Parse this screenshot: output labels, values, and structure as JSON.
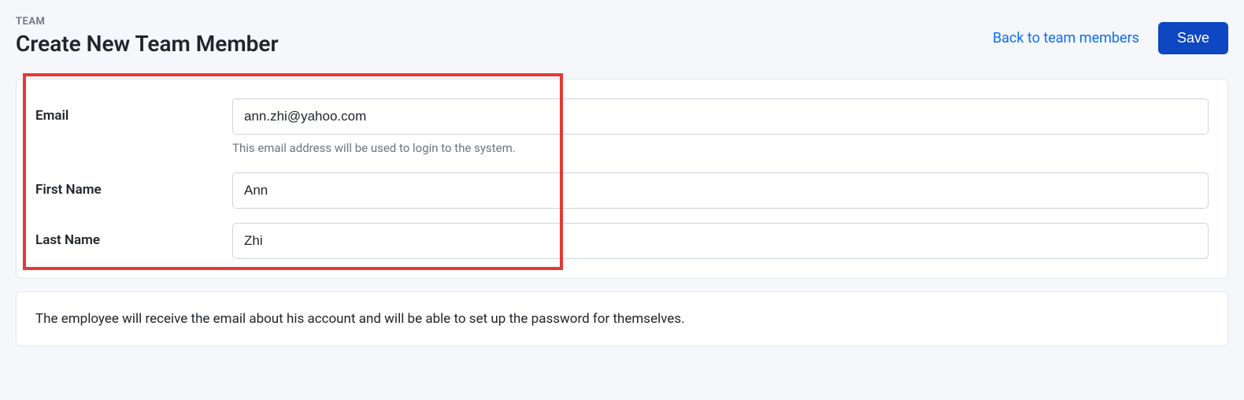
{
  "header": {
    "breadcrumb": "TEAM",
    "title": "Create New Team Member",
    "back_link": "Back to team members",
    "save_label": "Save"
  },
  "form": {
    "email": {
      "label": "Email",
      "value": "ann.zhi@yahoo.com",
      "help": "This email address will be used to login to the system."
    },
    "first_name": {
      "label": "First Name",
      "value": "Ann"
    },
    "last_name": {
      "label": "Last Name",
      "value": "Zhi"
    }
  },
  "info": {
    "text": "The employee will receive the email about his account and will be able to set up the password for themselves."
  }
}
